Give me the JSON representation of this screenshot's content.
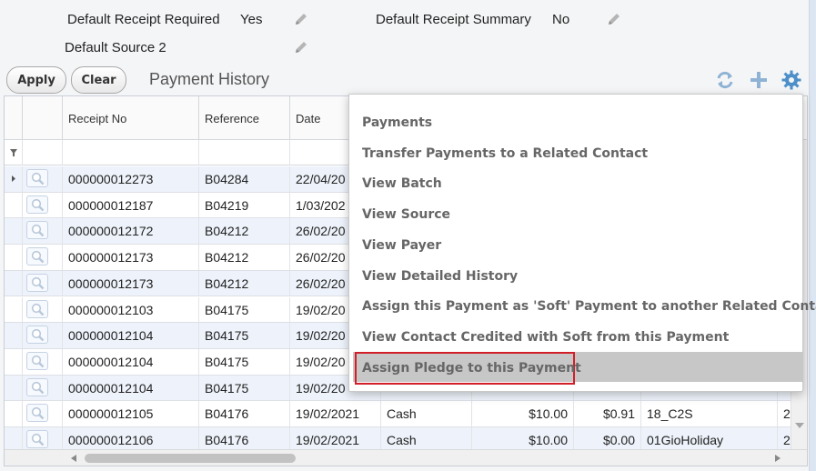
{
  "fields": {
    "default_receipt_required": {
      "label": "Default Receipt Required",
      "value": "Yes"
    },
    "default_receipt_summary": {
      "label": "Default Receipt Summary",
      "value": "No"
    },
    "default_source_2": {
      "label": "Default Source 2",
      "value": ""
    }
  },
  "toolbar": {
    "apply_label": "Apply",
    "clear_label": "Clear",
    "section_title": "Payment History",
    "icons": [
      "refresh-icon",
      "plus-icon",
      "gear-icon"
    ]
  },
  "colors": {
    "accent": "#4d8fc8",
    "highlight_border": "#d11f2a",
    "alt_row": "#eef3fb"
  },
  "grid": {
    "columns": [
      "Receipt No",
      "Reference",
      "Date"
    ],
    "rows": [
      {
        "receipt": "000000012273",
        "reference": "B04284",
        "date": "22/04/20",
        "type": "",
        "amount": "",
        "fee": "",
        "source": ""
      },
      {
        "receipt": "000000012187",
        "reference": "B04219",
        "date": "1/03/202",
        "type": "",
        "amount": "",
        "fee": "",
        "source": ""
      },
      {
        "receipt": "000000012172",
        "reference": "B04212",
        "date": "26/02/20",
        "type": "",
        "amount": "",
        "fee": "",
        "source": ""
      },
      {
        "receipt": "000000012173",
        "reference": "B04212",
        "date": "26/02/20",
        "type": "",
        "amount": "",
        "fee": "",
        "source": ""
      },
      {
        "receipt": "000000012173",
        "reference": "B04212",
        "date": "26/02/20",
        "type": "",
        "amount": "",
        "fee": "",
        "source": ""
      },
      {
        "receipt": "000000012103",
        "reference": "B04175",
        "date": "19/02/20",
        "type": "",
        "amount": "",
        "fee": "",
        "source": ""
      },
      {
        "receipt": "000000012104",
        "reference": "B04175",
        "date": "19/02/20",
        "type": "",
        "amount": "",
        "fee": "",
        "source": ""
      },
      {
        "receipt": "000000012104",
        "reference": "B04175",
        "date": "19/02/20",
        "type": "",
        "amount": "",
        "fee": "",
        "source": ""
      },
      {
        "receipt": "000000012104",
        "reference": "B04175",
        "date": "19/02/20",
        "type": "",
        "amount": "",
        "fee": "",
        "source": ""
      },
      {
        "receipt": "000000012105",
        "reference": "B04176",
        "date": "19/02/2021",
        "type": "Cash",
        "amount": "$10.00",
        "fee": "$0.91",
        "source": "18_C2S"
      },
      {
        "receipt": "000000012106",
        "reference": "B04176",
        "date": "19/02/2021",
        "type": "Cash",
        "amount": "$10.00",
        "fee": "$0.00",
        "source": "01GioHoliday"
      }
    ],
    "extra_right": [
      "2",
      "2"
    ]
  },
  "context_menu": {
    "items": [
      "Payments",
      "Transfer Payments to a Related Contact",
      "View Batch",
      "View Source",
      "View Payer",
      "View Detailed History",
      "Assign this Payment as 'Soft' Payment to another Related Contact",
      "View Contact Credited with Soft from this Payment",
      "Assign Pledge to this Payment"
    ],
    "highlighted_index": 8
  }
}
